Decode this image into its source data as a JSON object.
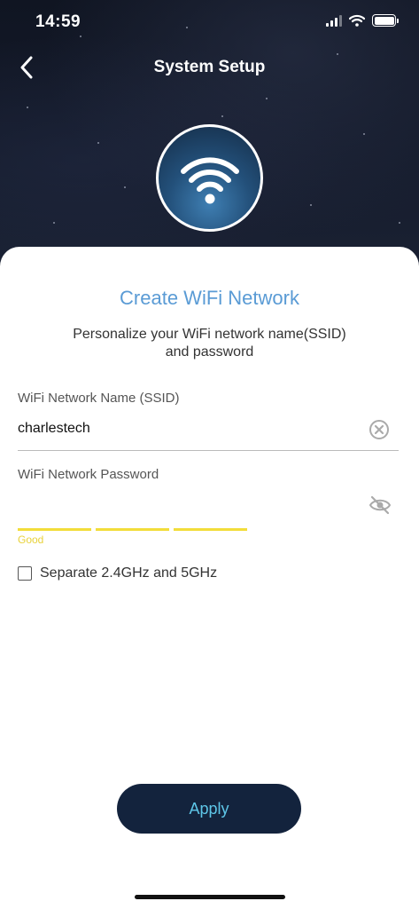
{
  "status_bar": {
    "time": "14:59",
    "signal_icon": "cellular-signal-icon",
    "wifi_icon": "wifi-status-icon",
    "battery_icon": "battery-icon"
  },
  "nav": {
    "back_icon": "chevron-left-icon",
    "title": "System Setup"
  },
  "hero": {
    "icon": "wifi-icon"
  },
  "card": {
    "title": "Create WiFi Network",
    "subtitle_line1": "Personalize your WiFi network name(SSID)",
    "subtitle_line2": "and password",
    "ssid": {
      "label": "WiFi Network Name (SSID)",
      "value": "charlestech",
      "clear_icon": "clear-circle-icon"
    },
    "password": {
      "label": "WiFi Network Password",
      "value": "",
      "visibility_icon": "eye-off-icon",
      "strength_text": "Good",
      "strength_segments": 3
    },
    "separate_bands": {
      "label": "Separate 2.4GHz and 5GHz",
      "checked": false
    },
    "apply_label": "Apply"
  },
  "colors": {
    "title_blue": "#5a9bd5",
    "apply_bg": "#13233d",
    "apply_text": "#5ec6e8",
    "strength_yellow": "#f2dd3a"
  }
}
